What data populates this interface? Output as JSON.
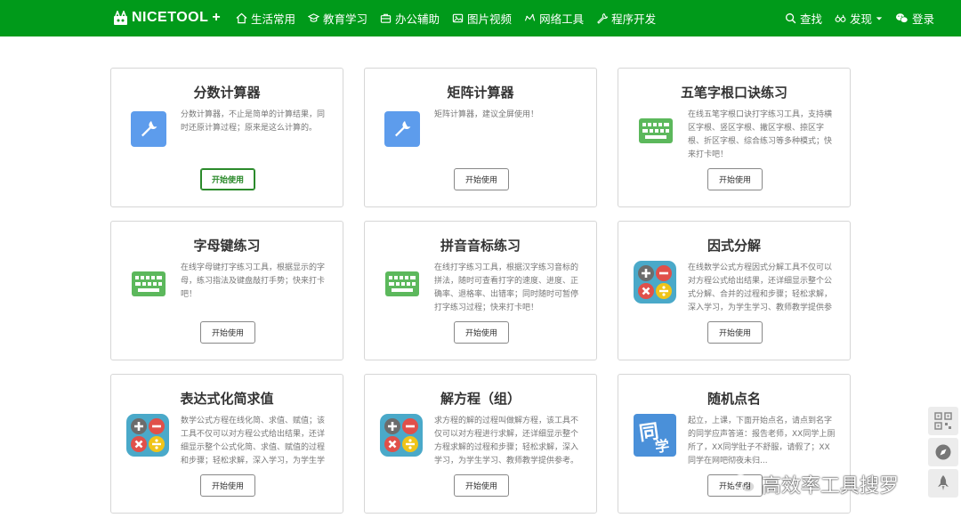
{
  "header": {
    "brand": "NICETOOL",
    "brand_plus": "+",
    "nav": [
      {
        "label": "生活常用",
        "icon": "home-icon"
      },
      {
        "label": "教育学习",
        "icon": "graduation-cap-icon"
      },
      {
        "label": "办公辅助",
        "icon": "briefcase-icon"
      },
      {
        "label": "图片视频",
        "icon": "image-icon"
      },
      {
        "label": "网络工具",
        "icon": "network-icon"
      },
      {
        "label": "程序开发",
        "icon": "wrench-icon"
      }
    ],
    "right": {
      "search": "查找",
      "discover": "发现",
      "login": "登录"
    },
    "colors": {
      "bar": "#009a1a"
    }
  },
  "cards": [
    {
      "title": "分数计算器",
      "desc": "分数计算器，不止是简单的计算结果，同时还原计算过程；原来是这么计算的。",
      "button": "开始使用",
      "icon": "wrench-icon"
    },
    {
      "title": "矩阵计算器",
      "desc": "矩阵计算器，建议全屏使用！",
      "button": "开始使用",
      "icon": "wrench-icon"
    },
    {
      "title": "五笔字根口诀练习",
      "desc": "在线五笔字根口诀打字练习工具，支持横区字根、竖区字根、撇区字根、捺区字根、折区字根、综合练习等多种模式；快来打卡吧！",
      "button": "开始使用",
      "icon": "keyboard-icon"
    },
    {
      "title": "字母键练习",
      "desc": "在线字母键打字练习工具，根据显示的字母，练习指法及键盘敲打手势；快来打卡吧！",
      "button": "开始使用",
      "icon": "keyboard-icon"
    },
    {
      "title": "拼音音标练习",
      "desc": "在线打字练习工具，根据汉字练习音标的拼法，随时可查看打字的速度、进度、正确率、退格率、出错率；同时随时可暂停打字练习过程；快来打卡吧！",
      "button": "开始使用",
      "icon": "keyboard-icon"
    },
    {
      "title": "因式分解",
      "desc": "在线数学公式方程因式分解工具不仅可以对方程公式给出结果，还详细显示整个公式分解、合并的过程和步骤；轻松求解，深入学习，为学生学习、教师教学提供参",
      "button": "开始使用",
      "icon": "math-operators-icon"
    },
    {
      "title": "表达式化简求值",
      "desc": "数学公式方程在线化简、求值、赋值；该工具不仅可以对方程公式给出结果，还详细显示整个公式化简、求值、赋值的过程和步骤；轻松求解，深入学习，为学生学",
      "button": "开始使用",
      "icon": "math-operators-icon"
    },
    {
      "title": "解方程（组）",
      "desc": "求方程的解的过程叫做解方程，该工具不仅可以对方程进行求解，还详细显示整个方程求解的过程和步骤；轻松求解，深入学习，为学生学习、教师教学提供参考。",
      "button": "开始使用",
      "icon": "math-operators-icon"
    },
    {
      "title": "随机点名",
      "desc": "起立，上课，下面开始点名，请点到名字的同学应声答道：报告老师，XX同学上厕所了，XX同学肚子不舒服，请假了；XX同学在网吧彻夜未归...",
      "button": "开始使用",
      "icon": "tong-xue-icon",
      "icon_text_top": "同",
      "icon_text_bottom": "学"
    }
  ],
  "watermark": "高效率工具搜罗",
  "sidebar": [
    "qr-code-icon",
    "compass-icon",
    "rocket-icon"
  ]
}
